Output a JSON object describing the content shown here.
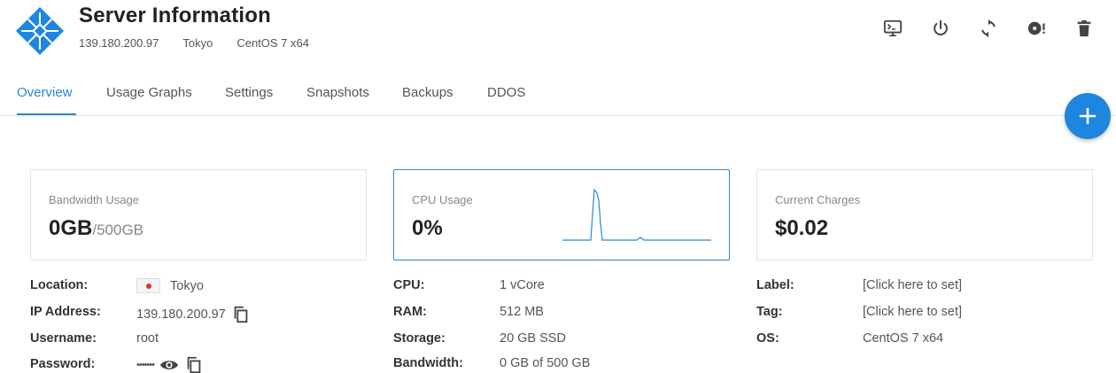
{
  "header": {
    "title": "Server Information",
    "ip": "139.180.200.97",
    "location": "Tokyo",
    "os": "CentOS 7 x64"
  },
  "actions": [
    {
      "name": "console-icon"
    },
    {
      "name": "power-icon"
    },
    {
      "name": "restart-icon"
    },
    {
      "name": "reinstall-icon"
    },
    {
      "name": "trash-icon"
    }
  ],
  "tabs": [
    {
      "label": "Overview",
      "active": true
    },
    {
      "label": "Usage Graphs"
    },
    {
      "label": "Settings"
    },
    {
      "label": "Snapshots"
    },
    {
      "label": "Backups"
    },
    {
      "label": "DDOS"
    }
  ],
  "cards": {
    "bandwidth": {
      "label": "Bandwidth Usage",
      "value": "0GB",
      "sub": "/500GB"
    },
    "cpu": {
      "label": "CPU Usage",
      "value": "0%"
    },
    "charges": {
      "label": "Current Charges",
      "value": "$0.02"
    }
  },
  "details_left": {
    "location_label": "Location:",
    "location_value": "Tokyo",
    "ip_label": "IP Address:",
    "ip_value": "139.180.200.97",
    "username_label": "Username:",
    "username_value": "root",
    "password_label": "Password:",
    "password_value": "•••••••"
  },
  "details_mid": {
    "cpu_label": "CPU:",
    "cpu_value": "1 vCore",
    "ram_label": "RAM:",
    "ram_value": "512 MB",
    "storage_label": "Storage:",
    "storage_value": "20 GB SSD",
    "bandwidth_label": "Bandwidth:",
    "bandwidth_value": "0 GB of 500 GB"
  },
  "details_right": {
    "label_label": "Label:",
    "label_value": "[Click here to set]",
    "tag_label": "Tag:",
    "tag_value": "[Click here to set]",
    "os_label": "OS:",
    "os_value": "CentOS 7 x64"
  },
  "colors": {
    "accent": "#2a87d6",
    "fab": "#1f86e0",
    "logo": "#1f86e0"
  }
}
